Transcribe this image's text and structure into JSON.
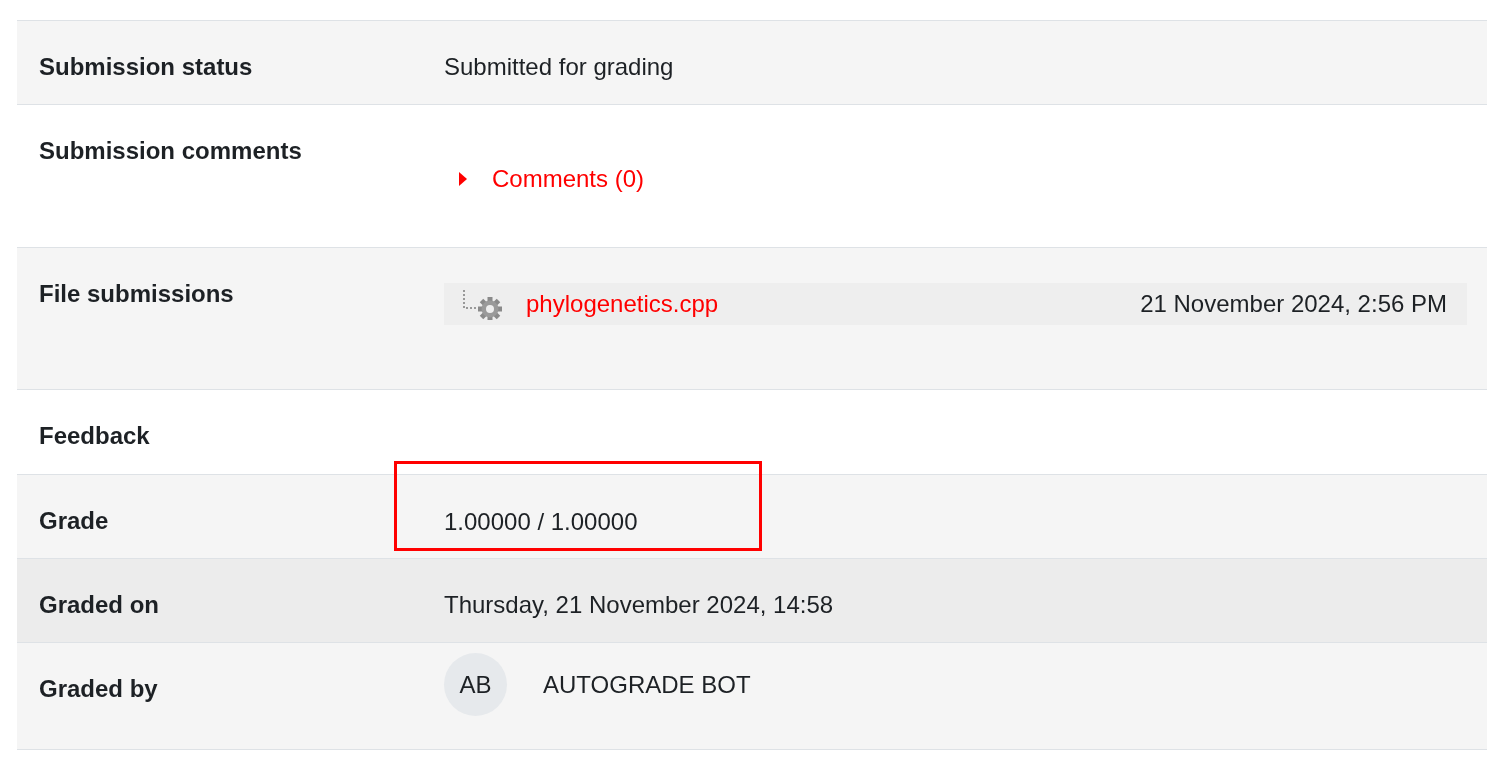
{
  "rows": [
    {
      "label": "Submission status",
      "kind": "text",
      "value": "Submitted for grading"
    },
    {
      "label": "Submission comments",
      "kind": "comments",
      "value": "Comments (0)",
      "expanded": false
    },
    {
      "label": "File submissions",
      "kind": "file",
      "file": "phylogenetics.cpp",
      "date": "21 November 2024, 2:56 PM"
    },
    {
      "label": "Feedback",
      "kind": "heading"
    },
    {
      "label": "Grade",
      "kind": "text",
      "value": "1.00000 / 1.00000",
      "highlighted": true
    },
    {
      "label": "Graded on",
      "kind": "text",
      "value": "Thursday, 21 November 2024, 14:58",
      "hovered": true
    },
    {
      "label": "Graded by",
      "kind": "user",
      "initials": "AB",
      "value": "AUTOGRADE BOT"
    }
  ]
}
